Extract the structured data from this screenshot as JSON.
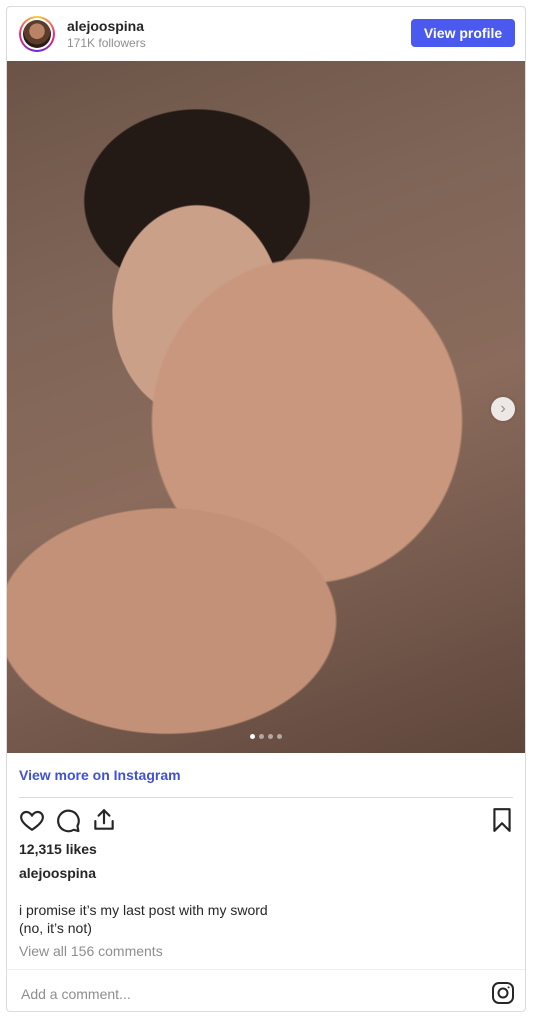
{
  "header": {
    "username": "alejoospina",
    "followers": "171K followers",
    "view_profile_label": "View profile"
  },
  "post": {
    "carousel": {
      "slide_count": 4,
      "active_slide": 1
    },
    "view_more_label": "View more on Instagram",
    "likes": "12,315 likes",
    "caption_user": "alejoospina",
    "caption_line1": "i promise it’s my last post with my sword",
    "caption_line2": "(no, it’s not)",
    "comments_link": "View all 156 comments",
    "add_comment_placeholder": "Add a comment..."
  },
  "icons": [
    "heart-icon",
    "comment-icon",
    "share-icon",
    "bookmark-icon",
    "instagram-icon",
    "chevron-right-icon"
  ],
  "colors": {
    "accent": "#4a5aef",
    "link": "#3f51d8"
  }
}
